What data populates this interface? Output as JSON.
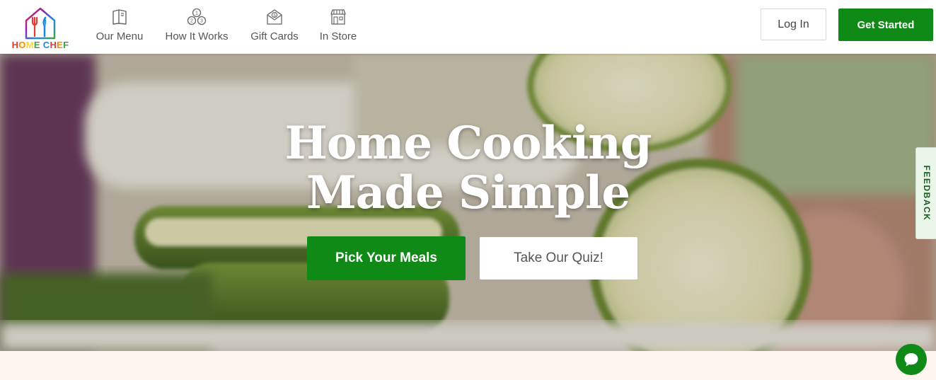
{
  "header": {
    "logo": {
      "text": "HOME CHEF",
      "letter_colors": [
        "#e53935",
        "#fb8c00",
        "#fdd835",
        "#43a047",
        "#1e88e5",
        "#e53935",
        "#fb8c00",
        "#43a047",
        "#1e88e5"
      ]
    },
    "nav": [
      {
        "label": "Our Menu",
        "icon": "menu-book-icon"
      },
      {
        "label": "How It Works",
        "icon": "process-steps-icon"
      },
      {
        "label": "Gift Cards",
        "icon": "gift-envelope-icon"
      },
      {
        "label": "In Store",
        "icon": "storefront-icon"
      }
    ],
    "login_label": "Log In",
    "get_started_label": "Get Started"
  },
  "hero": {
    "title_line1": "Home Cooking",
    "title_line2": "Made Simple",
    "pick_meals_label": "Pick Your Meals",
    "quiz_label": "Take Our Quiz!"
  },
  "feedback_label": "FEEDBACK",
  "chat_icon": "chat-bubble-icon",
  "colors": {
    "brand_green": "#0f8a17",
    "nav_text": "#555555",
    "page_bottom": "#fdf6f0"
  }
}
